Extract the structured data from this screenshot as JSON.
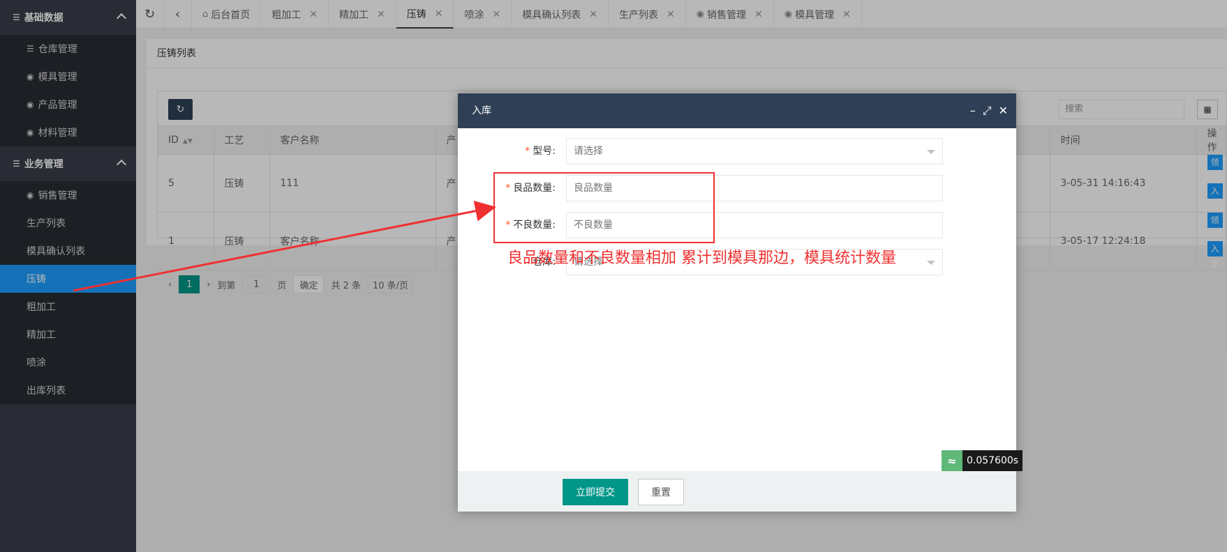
{
  "sidebar": {
    "groups": [
      {
        "title": "基础数据",
        "items": [
          {
            "label": "仓库管理"
          },
          {
            "label": "模具管理"
          },
          {
            "label": "产品管理"
          },
          {
            "label": "材料管理"
          }
        ]
      },
      {
        "title": "业务管理",
        "items": [
          {
            "label": "销售管理"
          },
          {
            "label": "生产列表"
          },
          {
            "label": "模具确认列表"
          },
          {
            "label": "压铸"
          },
          {
            "label": "粗加工"
          },
          {
            "label": "精加工"
          },
          {
            "label": "喷涂"
          },
          {
            "label": "出库列表"
          }
        ]
      }
    ],
    "active_item": "压铸"
  },
  "tabs": [
    {
      "label": "后台首页"
    },
    {
      "label": "粗加工"
    },
    {
      "label": "精加工"
    },
    {
      "label": "压铸"
    },
    {
      "label": "喷涂"
    },
    {
      "label": "模具确认列表"
    },
    {
      "label": "生产列表"
    },
    {
      "label": "销售管理"
    },
    {
      "label": "模具管理"
    }
  ],
  "page": {
    "title": "压铸列表",
    "search_placeholder": "搜索",
    "table": {
      "headers": [
        "ID",
        "工艺",
        "客户名称",
        "产",
        "时间",
        "操作"
      ],
      "rows": [
        {
          "id": "5",
          "process": "压铸",
          "customer": "111",
          "product": "产",
          "time": "3-05-31 14:16:43"
        },
        {
          "id": "1",
          "process": "压铸",
          "customer": "客户名称",
          "product": "产",
          "time": "3-05-17 12:24:18"
        }
      ],
      "action_receive": "领取",
      "action_stock_in": "入库"
    },
    "pager": {
      "current": "1",
      "goto_label": "到第",
      "goto_value": "1",
      "page_label": "页",
      "confirm": "确定",
      "total": "共 2 条",
      "page_size": "10 条/页"
    }
  },
  "modal": {
    "title": "入库",
    "fields": [
      {
        "label": "型号:",
        "value": "请选择",
        "required": true
      },
      {
        "label": "良品数量:",
        "value": "良品数量",
        "required": true
      },
      {
        "label": "不良数量:",
        "value": "不良数量",
        "required": true
      },
      {
        "label": "仓库:",
        "value": "请选择",
        "required": false
      }
    ],
    "submit_label": "立即提交",
    "reset_label": "重置",
    "timer": "0.057600s"
  },
  "annotation": {
    "text": "良品数量和不良数量相加 累计到模具那边，模具统计数量"
  },
  "colors": {
    "sidebar_bg": "#393d49",
    "active": "#1e9fff",
    "primary": "#009688",
    "modal_header": "#2f4056",
    "annotation": "#f03030"
  }
}
